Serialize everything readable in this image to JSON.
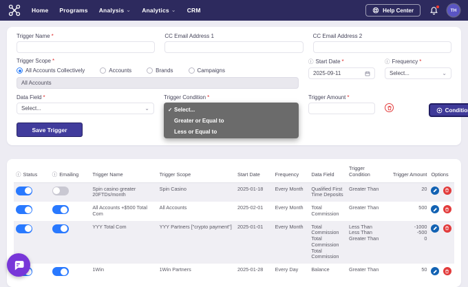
{
  "icons": {
    "required_mark": "*",
    "info": "ⓘ",
    "chevron_down": "⌄",
    "checkmark": "✓"
  },
  "nav": {
    "items": [
      {
        "label": "Home",
        "dropdown": false
      },
      {
        "label": "Programs",
        "dropdown": false
      },
      {
        "label": "Analysis",
        "dropdown": true
      },
      {
        "label": "Analytics",
        "dropdown": true
      },
      {
        "label": "CRM",
        "dropdown": false
      }
    ],
    "help_center_label": "Help Center",
    "avatar_initials": "TH"
  },
  "form": {
    "fields": {
      "trigger_name": {
        "label": "Trigger Name",
        "required": true,
        "value": ""
      },
      "cc_email_1": {
        "label": "CC Email Address 1",
        "required": false,
        "value": ""
      },
      "cc_email_2": {
        "label": "CC Email Address 2",
        "required": false,
        "value": ""
      },
      "trigger_scope": {
        "label": "Trigger Scope",
        "required": true,
        "options": [
          "All Accounts Collectively",
          "Accounts",
          "Brands",
          "Campaigns"
        ],
        "selected": "All Accounts Collectively",
        "scope_value": "All Accounts"
      },
      "start_date": {
        "label": "Start Date",
        "required": true,
        "value": "2025-09-11"
      },
      "frequency": {
        "label": "Frequency",
        "required": true,
        "value": "Select..."
      },
      "data_field": {
        "label": "Data Field",
        "required": true,
        "value": "Select..."
      },
      "trigger_condition": {
        "label": "Trigger Condition",
        "required": true,
        "options": [
          "Select...",
          "Greater or Equal to",
          "Less or Equal to"
        ],
        "selected": "Select..."
      },
      "trigger_amount": {
        "label": "Trigger Amount",
        "required": true,
        "value": ""
      }
    },
    "buttons": {
      "condition": "Condition",
      "save": "Save Trigger"
    }
  },
  "table": {
    "headers": [
      {
        "label": "Status",
        "info": true,
        "align": "left"
      },
      {
        "label": "Emailing",
        "info": true,
        "align": "left"
      },
      {
        "label": "Trigger Name",
        "info": false,
        "align": "left"
      },
      {
        "label": "Trigger Scope",
        "info": false,
        "align": "left"
      },
      {
        "label": "Start Date",
        "info": false,
        "align": "left"
      },
      {
        "label": "Frequency",
        "info": false,
        "align": "left"
      },
      {
        "label": "Data Field",
        "info": false,
        "align": "left"
      },
      {
        "label": "Trigger Condition",
        "info": false,
        "align": "left"
      },
      {
        "label": "Trigger Amount",
        "info": false,
        "align": "right"
      },
      {
        "label": "Options",
        "info": false,
        "align": "left"
      }
    ],
    "rows": [
      {
        "status": true,
        "emailing": false,
        "trigger_name": "Spin casino greater 20FTDs/month",
        "trigger_scope": "Spin Casino",
        "start_date": "2025-01-18",
        "frequency": "Every Month",
        "data_field": [
          "Qualified First Time Deposits"
        ],
        "trigger_condition": [
          "Greater Than"
        ],
        "trigger_amount": [
          "20"
        ]
      },
      {
        "status": true,
        "emailing": true,
        "trigger_name": "All Accounts +$500 Total Com",
        "trigger_scope": "All Accounts",
        "start_date": "2025-02-01",
        "frequency": "Every Month",
        "data_field": [
          "Total Commission"
        ],
        "trigger_condition": [
          "Greater Than"
        ],
        "trigger_amount": [
          "500"
        ]
      },
      {
        "status": true,
        "emailing": true,
        "trigger_name": "YYY Total Com",
        "trigger_scope": "YYY Partners [\"crypto payment\"]",
        "start_date": "2025-01-01",
        "frequency": "Every Month",
        "data_field": [
          "Total Commission",
          "Total Commission",
          "Total Commission"
        ],
        "trigger_condition": [
          "Less Than",
          "Less Than",
          "Greater Than"
        ],
        "trigger_amount": [
          "-1000",
          "-500",
          "0"
        ]
      },
      {
        "status": true,
        "emailing": true,
        "trigger_name": "1Win",
        "trigger_scope": "1Win Partners",
        "start_date": "2025-01-28",
        "frequency": "Every Day",
        "data_field": [
          "Balance"
        ],
        "trigger_condition": [
          "Greater Than"
        ],
        "trigger_amount": [
          "50"
        ]
      }
    ]
  },
  "colors": {
    "nav_bg": "#2d2a5e",
    "accent_indigo": "#3f3a99",
    "toggle_on": "#2979ff",
    "edit_icon": "#1262b3",
    "delete_icon": "#e23b3b",
    "radio_selected": "#2d7ff9",
    "dropdown_bg": "#6b6b6b",
    "page_bg": "#edecf3",
    "row_stripe": "#f0eff4"
  }
}
